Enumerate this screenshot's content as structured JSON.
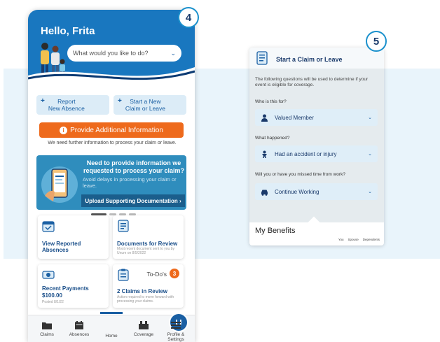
{
  "badges": {
    "step4": "4",
    "step5": "5"
  },
  "colors": {
    "primary": "#1977bf",
    "accent": "#ee6a1c",
    "navy": "#1a3a6b",
    "band": "#e9f4fb"
  },
  "home": {
    "greeting": "Hello, Frita",
    "search_placeholder": "What would you like to do?",
    "quick_actions": [
      {
        "line1": "Report",
        "line2": "New Absence"
      },
      {
        "line1": "Start a New",
        "line2": "Claim or Leave"
      }
    ],
    "alert_button": "Provide Additional Information",
    "alert_text": "We need further information to process your claim or leave.",
    "promo": {
      "heading": "Need to provide information we requested to process your claim?",
      "subtext": "Avoid delays in processing your claim or leave.",
      "button": "Upload Supporting Documentation"
    },
    "tiles": [
      {
        "title": "View Reported Absences",
        "sub": "",
        "icon": "calendar-check-icon"
      },
      {
        "title": "Documents for Review",
        "sub": "Most recent document sent to you by Unum on 8/5/2022",
        "icon": "document-icon"
      },
      {
        "title": "Recent Payments",
        "title2": "$100.00",
        "sub": "Posted 8/1/22",
        "icon": "payment-icon"
      },
      {
        "title": "2 Claims in Review",
        "sub": "Action required to move forward with processing your claims.",
        "todo_label": "To-Do's",
        "todo_count": "3",
        "icon": "clipboard-icon"
      }
    ],
    "nav": [
      {
        "label": "Claims",
        "icon": "folder-icon"
      },
      {
        "label": "Absences",
        "icon": "calendar-icon"
      },
      {
        "label": "Home",
        "icon": "home-logo-icon"
      },
      {
        "label": "Coverage",
        "icon": "coverage-icon"
      },
      {
        "label": "Profile & Settings",
        "icon": "menu-icon"
      }
    ]
  },
  "claim_form": {
    "title": "Start a Claim or Leave",
    "intro": "The following questions will be used to determine if your event is eligible for coverage.",
    "questions": [
      {
        "label": "Who is this for?",
        "value": "Valued Member",
        "icon": "person-icon"
      },
      {
        "label": "What happened?",
        "value": "Had an accident or injury",
        "icon": "injury-icon"
      },
      {
        "label": "Will you or have you missed time from work?",
        "value": "Continue Working",
        "icon": "car-icon"
      }
    ],
    "benefits_title": "My Benefits",
    "benefits_tabs": [
      "You",
      "Spouse",
      "Dependents"
    ]
  }
}
